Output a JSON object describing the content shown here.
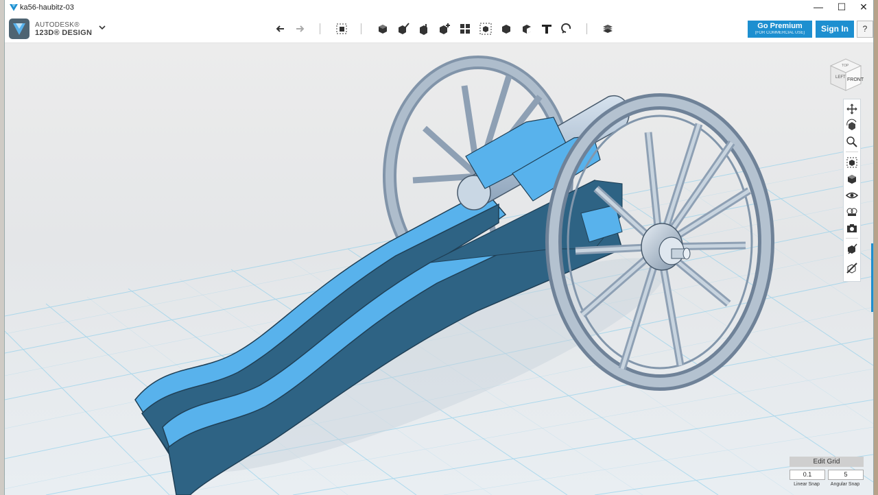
{
  "window": {
    "title": "ka56-haubitz-03"
  },
  "window_controls": {
    "minimize": "—",
    "maximize": "☐",
    "close": "✕"
  },
  "brand": {
    "line1": "AUTODESK®",
    "line2": "123D® DESIGN"
  },
  "toolbar": {
    "icons": [
      "undo-icon",
      "redo-icon",
      "transform-icon",
      "primitives-icon",
      "sketch-icon",
      "construct-icon",
      "modify-icon",
      "pattern-icon",
      "grouping-icon",
      "combine-icon",
      "measure-icon",
      "text-icon",
      "snap-icon",
      "material-icon"
    ]
  },
  "premium": {
    "title": "Go Premium",
    "subtitle": "(FOR COMMERCIAL USE)"
  },
  "signin": {
    "label": "Sign In"
  },
  "help": {
    "label": "?"
  },
  "viewcube": {
    "front": "FRONT",
    "left": "LEFT",
    "top": "TOP"
  },
  "navbar": {
    "icons": [
      "pan-icon",
      "orbit-icon",
      "zoom-icon",
      "fit-icon",
      "views-icon",
      "visibility-icon",
      "materials-icon",
      "camera-icon",
      "outliner-icon",
      "settings-icon"
    ]
  },
  "grid": {
    "edit_label": "Edit Grid",
    "linear_snap": "0.1",
    "angular_snap": "5",
    "linear_label": "Linear Snap",
    "angular_label": "Angular Snap"
  },
  "colors": {
    "brand_blue": "#1d8fd0",
    "model_light": "#58b2ec",
    "model_dark": "#2e6384",
    "wheel_gray": "#9fb0c2",
    "viewport_bg": "#e8e8e8",
    "grid_line": "#7cc9ea"
  }
}
